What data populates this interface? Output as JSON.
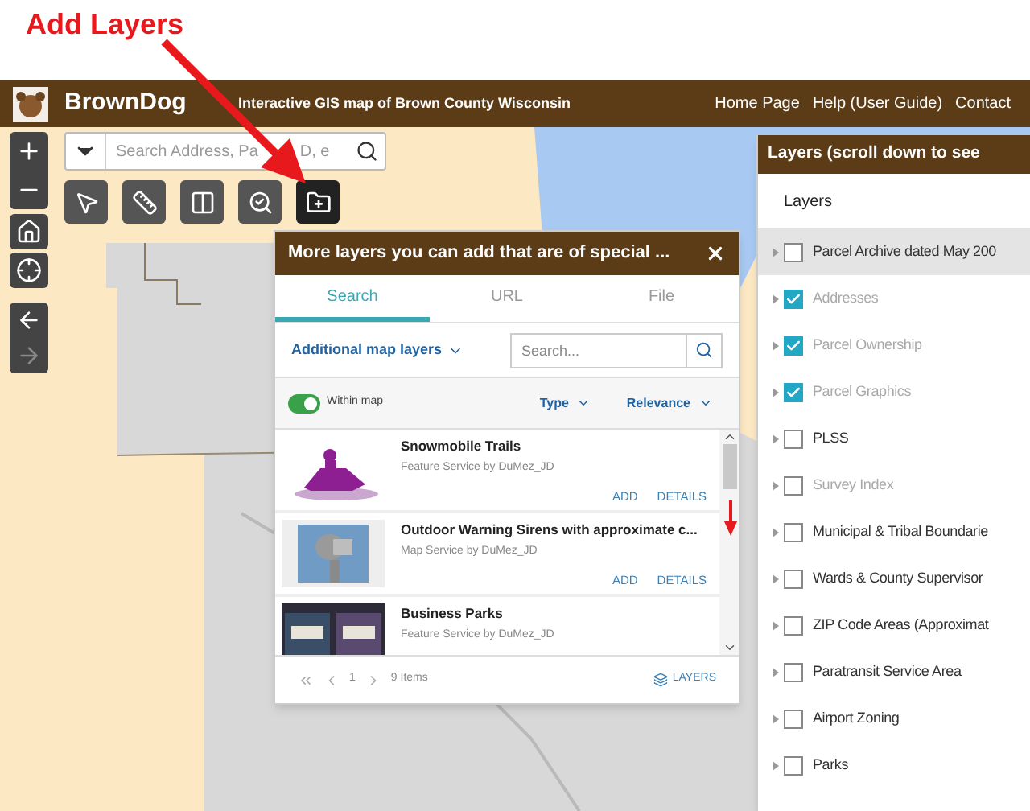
{
  "annotation": {
    "label": "Add Layers"
  },
  "header": {
    "title": "BrownDog",
    "subtitle": "Interactive GIS map of Brown County Wisconsin",
    "links": [
      "Home Page",
      "Help (User Guide)",
      "Contact"
    ]
  },
  "search": {
    "placeholder_parts": [
      "Search Address, Pa",
      "D, e"
    ]
  },
  "toolbar": [
    {
      "kind": "select",
      "selected": false
    },
    {
      "kind": "measure",
      "selected": false
    },
    {
      "kind": "compare",
      "selected": false
    },
    {
      "kind": "find",
      "selected": false
    },
    {
      "kind": "add",
      "selected": true
    }
  ],
  "add_layers": {
    "title": "More layers you can add that are of special ...",
    "tabs": [
      {
        "label": "Search",
        "selected": true
      },
      {
        "label": "URL",
        "selected": false
      },
      {
        "label": "File",
        "selected": false
      }
    ],
    "scope": "Additional map layers",
    "search_placeholder": "Search...",
    "within_map": {
      "label": "Within map",
      "on": true
    },
    "sorts": [
      "Type",
      "Relevance"
    ],
    "items": [
      {
        "kind": "snowmobile",
        "title": "Snowmobile Trails",
        "source": "Feature Service by DuMez_JD",
        "actions": [
          "ADD",
          "DETAILS"
        ]
      },
      {
        "kind": "siren",
        "title": "Outdoor Warning Sirens with approximate c...",
        "source": "Map Service by DuMez_JD",
        "actions": [
          "ADD",
          "DETAILS"
        ]
      },
      {
        "kind": "signs",
        "title": "Business Parks",
        "source": "Feature Service by DuMez_JD"
      }
    ],
    "pager": {
      "page": "1",
      "count": "9 Items"
    },
    "layers_button": "LAYERS"
  },
  "layers": {
    "title": "Layers (scroll down to see",
    "heading": "Layers",
    "items": [
      {
        "label": "Parcel Archive dated May 200",
        "checked": false,
        "dimmed": false,
        "selected": true
      },
      {
        "label": "Addresses",
        "checked": true,
        "dimmed": true,
        "selected": false
      },
      {
        "label": "Parcel Ownership",
        "checked": true,
        "dimmed": true,
        "selected": false
      },
      {
        "label": "Parcel Graphics",
        "checked": true,
        "dimmed": true,
        "selected": false
      },
      {
        "label": "PLSS",
        "checked": false,
        "dimmed": false,
        "selected": false
      },
      {
        "label": "Survey Index",
        "checked": false,
        "dimmed": true,
        "selected": false
      },
      {
        "label": "Municipal & Tribal Boundarie",
        "checked": false,
        "dimmed": false,
        "selected": false
      },
      {
        "label": "Wards & County Supervisor",
        "checked": false,
        "dimmed": false,
        "selected": false
      },
      {
        "label": "ZIP Code Areas (Approximat",
        "checked": false,
        "dimmed": false,
        "selected": false
      },
      {
        "label": "Paratransit Service Area",
        "checked": false,
        "dimmed": false,
        "selected": false
      },
      {
        "label": "Airport Zoning",
        "checked": false,
        "dimmed": false,
        "selected": false
      },
      {
        "label": "Parks",
        "checked": false,
        "dimmed": false,
        "selected": false
      }
    ]
  }
}
